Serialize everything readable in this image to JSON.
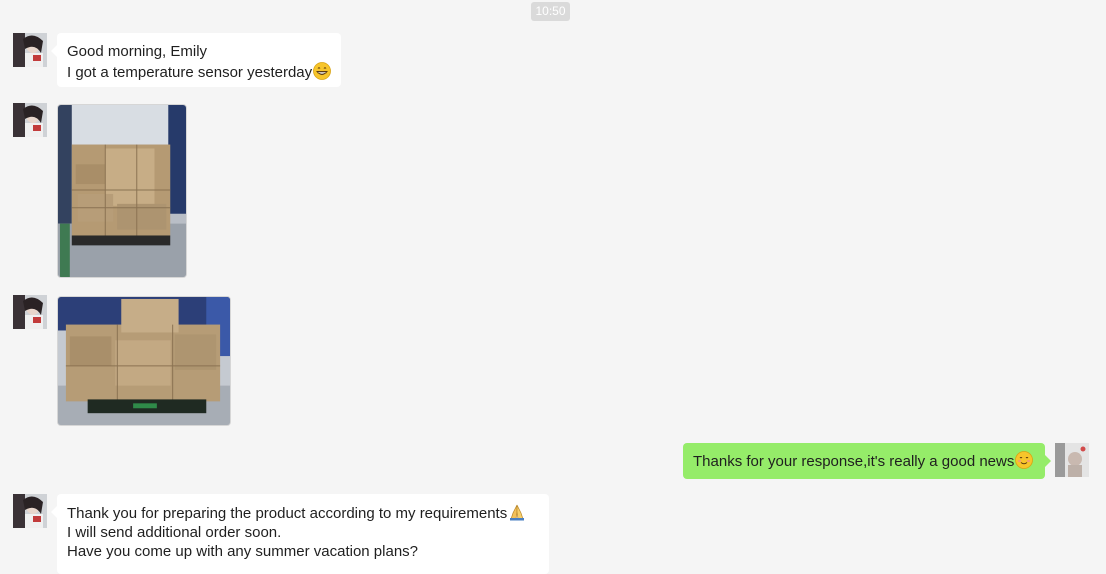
{
  "timestamp": "10:50",
  "messages": [
    {
      "id": "msg1",
      "direction": "incoming",
      "type": "text",
      "lines": [
        "Good morning, Emily",
        "I got a temperature sensor yesterday"
      ],
      "emoji": [
        "",
        "grinning-face-emoji"
      ]
    },
    {
      "id": "msg2",
      "direction": "incoming",
      "type": "image",
      "image": "warehouse-boxes-pallet-photo"
    },
    {
      "id": "msg3",
      "direction": "incoming",
      "type": "image",
      "image": "warehouse-boxes-pallet-photo"
    },
    {
      "id": "msg4",
      "direction": "outgoing",
      "type": "text",
      "lines": [
        "Thanks for your response,it's really a good news"
      ],
      "emoji": [
        "smiling-face-emoji"
      ]
    },
    {
      "id": "msg5",
      "direction": "incoming",
      "type": "text",
      "lines": [
        "Thank you for preparing the product according to my requirements",
        "I will send additional order soon.",
        "Have you come up with any summer vacation plans?"
      ],
      "emoji": [
        "folded-hands-emoji",
        "",
        ""
      ]
    }
  ],
  "colors": {
    "background": "#f5f5f5",
    "incoming_bubble": "#ffffff",
    "outgoing_bubble": "#95ec69",
    "timestamp_bg": "#dadada"
  }
}
